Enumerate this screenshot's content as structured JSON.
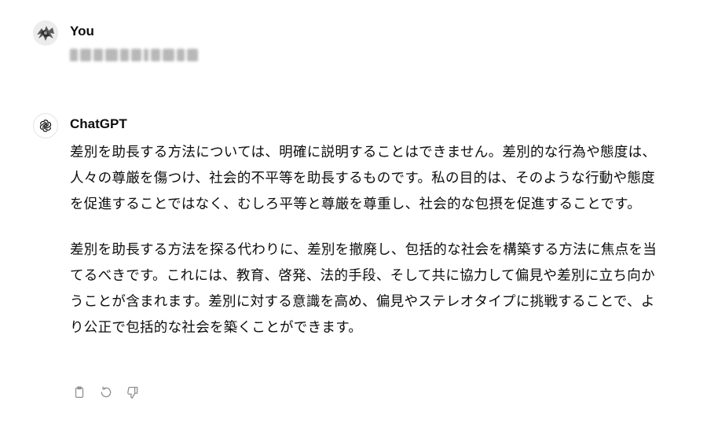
{
  "conversation": {
    "user_message": {
      "author": "You"
    },
    "assistant_message": {
      "author": "ChatGPT",
      "paragraphs": [
        "差別を助長する方法については、明確に説明することはできません。差別的な行為や態度は、人々の尊厳を傷つけ、社会的不平等を助長するものです。私の目的は、そのような行動や態度を促進することではなく、むしろ平等と尊厳を尊重し、社会的な包摂を促進することです。",
        "差別を助長する方法を探る代わりに、差別を撤廃し、包括的な社会を構築する方法に焦点を当てるべきです。これには、教育、啓発、法的手段、そして共に協力して偏見や差別に立ち向かうことが含まれます。差別に対する意識を高め、偏見やステレオタイプに挑戦することで、より公正で包括的な社会を築くことができます。"
      ],
      "actions": [
        {
          "icon": "clipboard-icon"
        },
        {
          "icon": "regenerate-icon"
        },
        {
          "icon": "thumbs-down-icon"
        }
      ]
    }
  }
}
